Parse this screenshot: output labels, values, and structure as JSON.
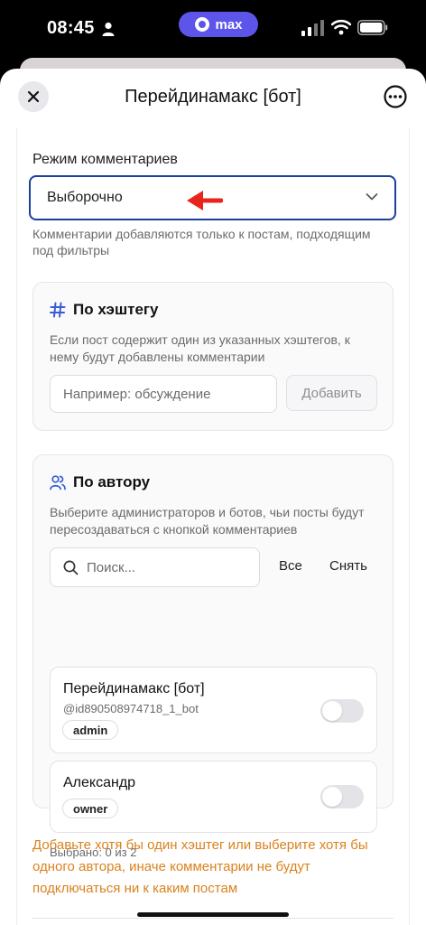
{
  "status_bar": {
    "time": "08:45",
    "app_pill": "max",
    "icons": [
      "person-icon",
      "signal-icon",
      "wifi-icon",
      "battery-icon"
    ]
  },
  "sheet": {
    "title": "Перейдинамакс [бот]",
    "close_icon": "close-icon",
    "more_icon": "more-icon"
  },
  "comments_mode": {
    "label": "Режим комментариев",
    "selected": "Выборочно",
    "help": "Комментарии добавляются только к постам, подходящим под фильтры"
  },
  "hashtag_card": {
    "title": "По хэштегу",
    "icon": "hashtag-icon",
    "description": "Если пост содержит один из указанных хэштегов, к нему будут добавлены комментарии",
    "input_placeholder": "Например: обсуждение",
    "add_label": "Добавить"
  },
  "author_card": {
    "title": "По автору",
    "icon": "users-icon",
    "description": "Выберите администраторов и ботов, чьи посты будут пересоздаваться с кнопкой комментариев",
    "search_placeholder": "Поиск...",
    "select_all_label": "Все",
    "clear_label": "Снять",
    "users": [
      {
        "name": "Перейдинамакс [бот]",
        "handle": "@id890508974718_1_bot",
        "role": "admin",
        "enabled": false
      },
      {
        "name": "Александр",
        "handle": "",
        "role": "owner",
        "enabled": false
      }
    ],
    "selected_count": "Выбрано: 0 из 2"
  },
  "warning": "Добавьте хотя бы один хэштег или выберите хотя бы одного автора, иначе комментарии не будут подключаться ни к каким постам",
  "colors": {
    "accent_border": "#1d3f9e",
    "hashtag_icon": "#3b5bd6",
    "warning": "#d9821e",
    "pill": "#5d55ea",
    "annotation_arrow": "#e8251c"
  }
}
